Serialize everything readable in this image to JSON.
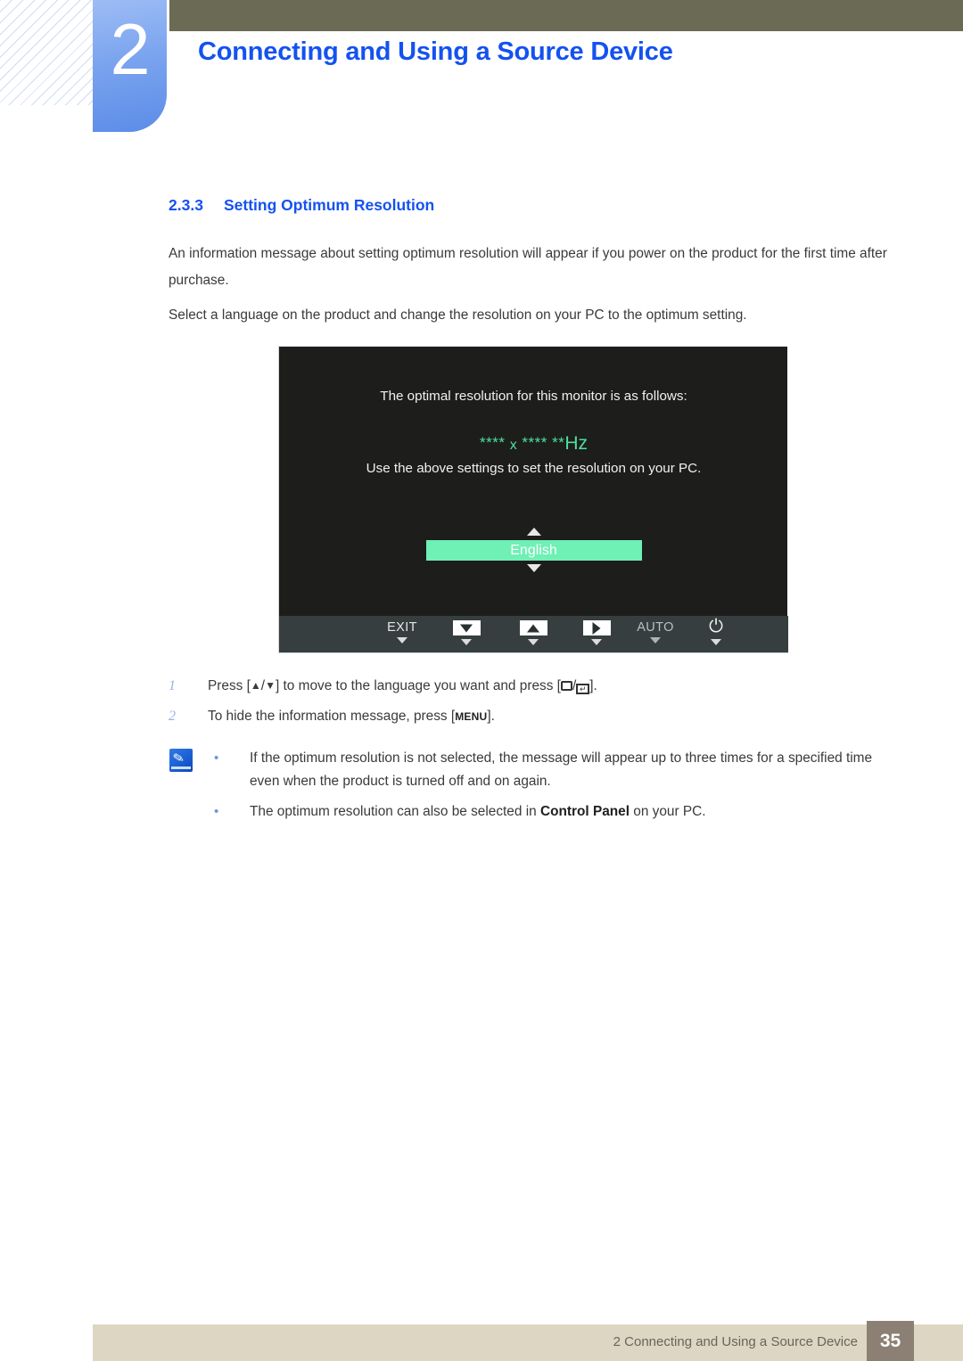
{
  "chapter": {
    "number": "2",
    "title": "Connecting and Using a Source Device"
  },
  "section": {
    "number": "2.3.3",
    "title": "Setting Optimum Resolution"
  },
  "paragraphs": {
    "p1": "An information message about setting optimum resolution will appear if you power on the product for the first time after purchase.",
    "p2": "Select a language on the product and change the resolution on your PC to the optimum setting."
  },
  "osd": {
    "line1": "The optimal resolution for this monitor is as follows:",
    "resolution_stars_left": "**** ",
    "resolution_x": "x",
    "resolution_stars_right": " **** **",
    "resolution_unit": "Hz",
    "line2": "Use the above settings to set the resolution on your PC.",
    "language_selected": "English",
    "accent_green": "#6ff0b5",
    "background": "#1d1d1b",
    "buttonbar_background": "#373e3f",
    "buttons": [
      {
        "label": "EXIT",
        "icon": "text-label",
        "dim": false
      },
      {
        "label": "",
        "icon": "down-arrow-icon",
        "dim": false
      },
      {
        "label": "",
        "icon": "up-arrow-icon",
        "dim": false
      },
      {
        "label": "",
        "icon": "right-arrow-icon",
        "dim": false
      },
      {
        "label": "AUTO",
        "icon": "text-label",
        "dim": true
      },
      {
        "label": "",
        "icon": "power-icon",
        "dim": false
      }
    ]
  },
  "steps": [
    {
      "index": "1",
      "prefix": "Press [",
      "keys_a": "▲",
      "keys_sep": "/",
      "keys_b": "▼",
      "middle": "] to move to the language you want and press [",
      "sep2": "/",
      "suffix": "]."
    },
    {
      "index": "2",
      "prefix": "To hide the information message, press [",
      "key": "MENU",
      "suffix": "]."
    }
  ],
  "notes": {
    "icon": "note-pen-icon",
    "items": [
      {
        "bullet": "•",
        "text": "If the optimum resolution is not selected, the message will appear up to three times for a specified time even when the product is turned off and on again.",
        "prefix": "",
        "bold": "",
        "suffix": ""
      },
      {
        "bullet": "•",
        "text": "",
        "prefix": "The optimum resolution can also be selected in ",
        "bold": "Control Panel",
        "suffix": " on your PC."
      }
    ]
  },
  "footer": {
    "text": "2 Connecting and Using a Source Device",
    "page": "35",
    "bar_color": "#dcd6c3",
    "page_box_color": "#8b8073"
  }
}
